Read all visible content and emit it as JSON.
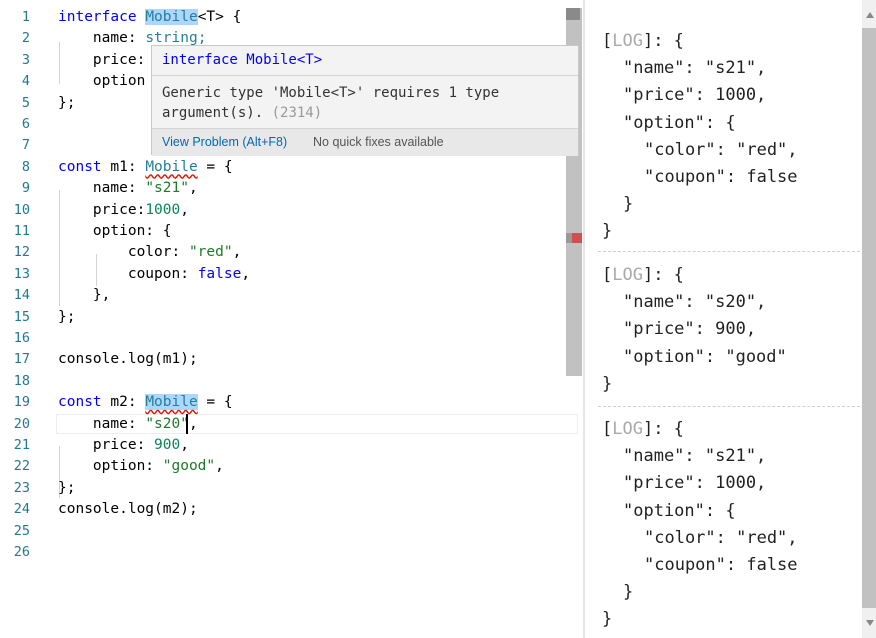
{
  "editor": {
    "line_numbers": [
      "1",
      "2",
      "3",
      "4",
      "5",
      "6",
      "7",
      "8",
      "9",
      "10",
      "11",
      "12",
      "13",
      "14",
      "15",
      "16",
      "17",
      "18",
      "19",
      "20",
      "21",
      "22",
      "23",
      "24",
      "25",
      "26"
    ],
    "lines": [
      [
        {
          "t": "interface",
          "c": "kw"
        },
        {
          "t": " "
        },
        {
          "t": "Mobile",
          "c": "ty hl"
        },
        {
          "t": "<T> {"
        }
      ],
      [
        {
          "t": "    name: "
        },
        {
          "t": "string;",
          "c": "ty"
        }
      ],
      [
        {
          "t": "    price: "
        }
      ],
      [
        {
          "t": "    option"
        }
      ],
      [
        {
          "t": "};"
        }
      ],
      [],
      [],
      [
        {
          "t": "const",
          "c": "kw"
        },
        {
          "t": " m1: "
        },
        {
          "t": "Mobile",
          "c": "ty squig"
        },
        {
          "t": " = {"
        }
      ],
      [
        {
          "t": "    name: "
        },
        {
          "t": "\"s21\"",
          "c": "strg"
        },
        {
          "t": ","
        }
      ],
      [
        {
          "t": "    price:"
        },
        {
          "t": "1000",
          "c": "num"
        },
        {
          "t": ","
        }
      ],
      [
        {
          "t": "    option: {"
        }
      ],
      [
        {
          "t": "        color: "
        },
        {
          "t": "\"red\"",
          "c": "strg"
        },
        {
          "t": ","
        }
      ],
      [
        {
          "t": "        coupon: "
        },
        {
          "t": "false",
          "c": "bool"
        },
        {
          "t": ","
        }
      ],
      [
        {
          "t": "    },"
        }
      ],
      [
        {
          "t": "};"
        }
      ],
      [],
      [
        {
          "t": "console.log(m1);"
        }
      ],
      [],
      [
        {
          "t": "const",
          "c": "kw"
        },
        {
          "t": " m2: "
        },
        {
          "t": "Mobile",
          "c": "ty squig hl"
        },
        {
          "t": " = {"
        }
      ],
      [
        {
          "t": "    name: "
        },
        {
          "t": "\"s20\"",
          "c": "strg"
        },
        {
          "t": ","
        }
      ],
      [
        {
          "t": "    price: "
        },
        {
          "t": "900",
          "c": "num"
        },
        {
          "t": ","
        }
      ],
      [
        {
          "t": "    option: "
        },
        {
          "t": "\"good\"",
          "c": "strg"
        },
        {
          "t": ","
        }
      ],
      [
        {
          "t": "};"
        }
      ],
      [
        {
          "t": "console.log(m2);"
        }
      ],
      []
    ]
  },
  "hover": {
    "signature": "interface Mobile<T>",
    "message": "Generic type 'Mobile<T>' requires 1 type argument(s).",
    "error_code": "(2314)",
    "view_problem": "View Problem (Alt+F8)",
    "no_quick_fix": "No quick fixes available"
  },
  "log_panel": {
    "entries": [
      {
        "lines": [
          {
            "level": 0,
            "parts": [
              {
                "t": "["
              },
              {
                "t": "LOG",
                "c": "lg"
              },
              {
                "t": "]: {"
              }
            ]
          },
          {
            "level": 1,
            "parts": [
              {
                "t": "\"name\": \"s21\","
              }
            ]
          },
          {
            "level": 1,
            "parts": [
              {
                "t": "\"price\": 1000,"
              }
            ]
          },
          {
            "level": 1,
            "parts": [
              {
                "t": "\"option\": {"
              }
            ]
          },
          {
            "level": 2,
            "parts": [
              {
                "t": "\"color\": \"red\","
              }
            ]
          },
          {
            "level": 2,
            "parts": [
              {
                "t": "\"coupon\": false"
              }
            ]
          },
          {
            "level": 1,
            "parts": [
              {
                "t": "}"
              }
            ]
          },
          {
            "level": 0,
            "parts": [
              {
                "t": "}"
              }
            ]
          }
        ]
      },
      {
        "lines": [
          {
            "level": 0,
            "parts": [
              {
                "t": "["
              },
              {
                "t": "LOG",
                "c": "lg"
              },
              {
                "t": "]: {"
              }
            ]
          },
          {
            "level": 1,
            "parts": [
              {
                "t": "\"name\": \"s20\","
              }
            ]
          },
          {
            "level": 1,
            "parts": [
              {
                "t": "\"price\": 900,"
              }
            ]
          },
          {
            "level": 1,
            "parts": [
              {
                "t": "\"option\": \"good\""
              }
            ]
          },
          {
            "level": 0,
            "parts": [
              {
                "t": "}"
              }
            ]
          }
        ]
      },
      {
        "lines": [
          {
            "level": 0,
            "parts": [
              {
                "t": "["
              },
              {
                "t": "LOG",
                "c": "lg"
              },
              {
                "t": "]: {"
              }
            ]
          },
          {
            "level": 1,
            "parts": [
              {
                "t": "\"name\": \"s21\","
              }
            ]
          },
          {
            "level": 1,
            "parts": [
              {
                "t": "\"price\": 1000,"
              }
            ]
          },
          {
            "level": 1,
            "parts": [
              {
                "t": "\"option\": {"
              }
            ]
          },
          {
            "level": 2,
            "parts": [
              {
                "t": "\"color\": \"red\","
              }
            ]
          },
          {
            "level": 2,
            "parts": [
              {
                "t": "\"coupon\": false"
              }
            ]
          },
          {
            "level": 1,
            "parts": [
              {
                "t": "}"
              }
            ]
          },
          {
            "level": 0,
            "parts": [
              {
                "t": "}"
              }
            ]
          }
        ]
      }
    ]
  }
}
